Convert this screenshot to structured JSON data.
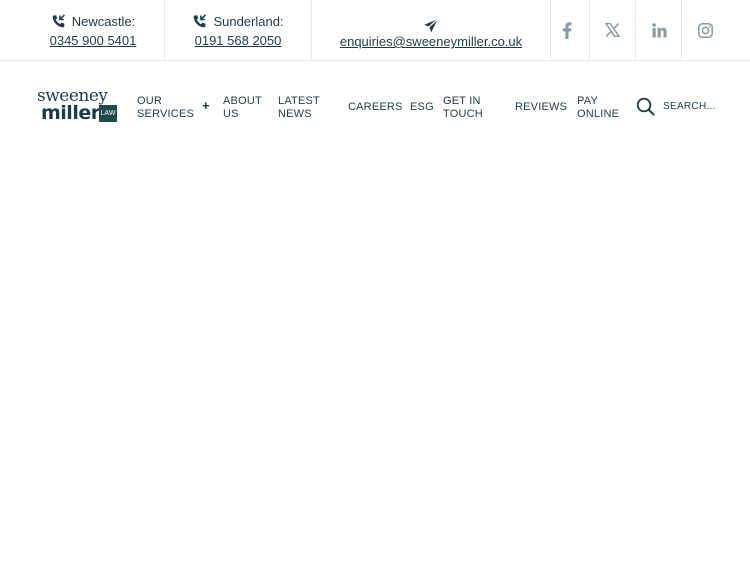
{
  "contacts": [
    {
      "label": "Newcastle:",
      "value": "0345 900 5401"
    },
    {
      "label": "Sunderland:",
      "value": "0191 568 2050"
    },
    {
      "value": "enquiries@sweeneymiller.co.uk"
    }
  ],
  "social": [
    "facebook-icon",
    "x-icon",
    "linkedin-icon",
    "instagram-icon"
  ],
  "logo": {
    "line1": "sweeney",
    "line2": "miller",
    "badge": "LAW"
  },
  "nav": {
    "our_services_1": "OUR",
    "our_services_2": "SERVICES",
    "about_1": "ABOUT",
    "about_2": "US",
    "news_1": "LATEST",
    "news_2": "NEWS",
    "careers": "CAREERS",
    "esg": "ESG",
    "touch_1": "GET IN",
    "touch_2": "TOUCH",
    "reviews": "REVIEWS",
    "pay_1": "PAY",
    "pay_2": "ONLINE",
    "expand_symbol": "+"
  },
  "search": {
    "placeholder": "SEARCH..."
  },
  "colors": {
    "brand": "#1d3b4c",
    "logo_badge": "#1f4a4c",
    "divider": "#e6e9eb",
    "social_icon": "#8a98a2"
  }
}
